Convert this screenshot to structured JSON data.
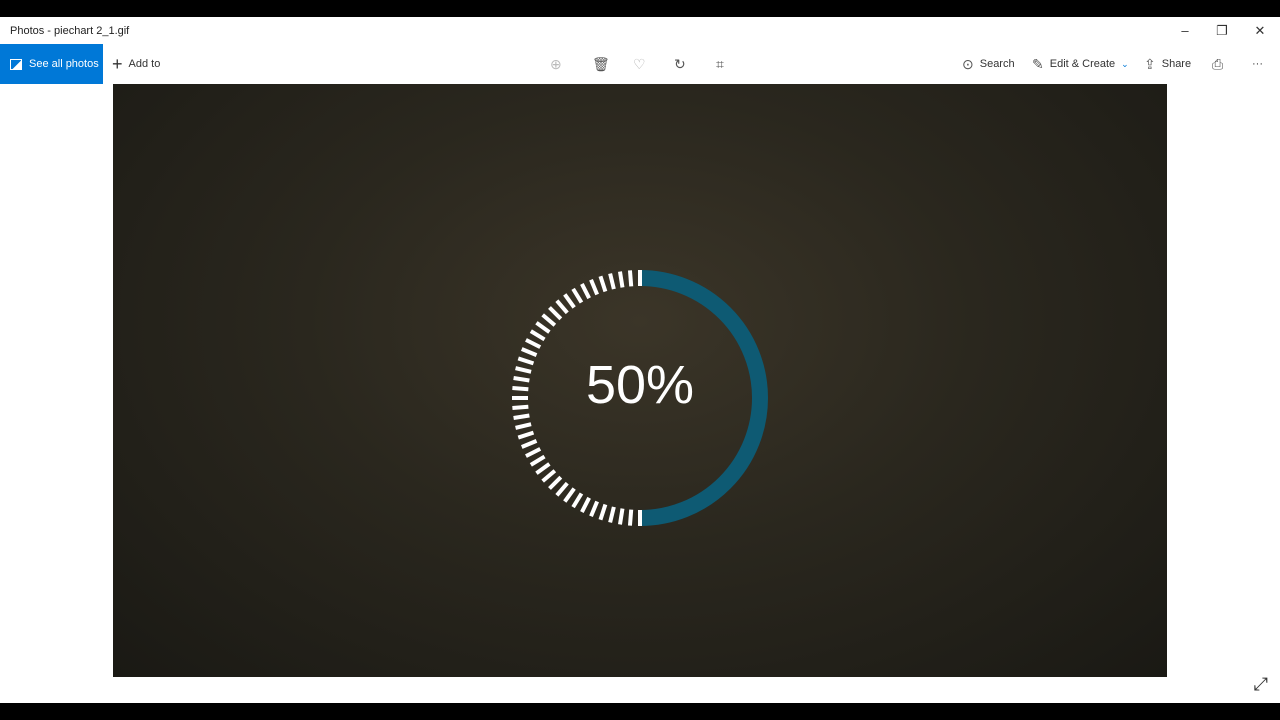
{
  "window": {
    "title": "Photos - piechart 2_1.gif",
    "minimize": "–",
    "restore": "❐",
    "close": "✕"
  },
  "toolbar": {
    "see_all": "See all photos",
    "add_to": "Add to",
    "search": "Search",
    "edit_create": "Edit & Create",
    "share": "Share",
    "more": "···"
  },
  "icons": [
    "zoom-icon",
    "delete-icon",
    "heart-icon",
    "rotate-icon",
    "crop-icon",
    "print-icon",
    "expand-icon"
  ],
  "image": {
    "percent_label": "50%",
    "progress": 0.5,
    "accent": "#0e5a73",
    "dash_color": "#ffffff"
  }
}
